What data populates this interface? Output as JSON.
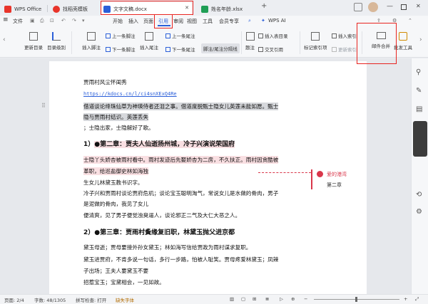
{
  "tabs": [
    {
      "label": "WPS Office"
    },
    {
      "label": "找稻壳模板"
    },
    {
      "label": "文字文稿.docx"
    },
    {
      "label": "姓名年龄.xlsx"
    }
  ],
  "menu": {
    "file": "文件",
    "items": [
      "开始",
      "插入",
      "页面",
      "引用",
      "审阅",
      "视图",
      "工具",
      "会员专享"
    ],
    "wps_ai": "WPS AI"
  },
  "ribbon": {
    "update_toc": "更新目录",
    "toc_level": "目录级别",
    "insert_footnote": "插入脚注",
    "prev_footnote": "上一条脚注",
    "next_footnote": "下一条脚注",
    "insert_endnote": "插入尾注",
    "prev_endnote": "上一条尾注",
    "next_endnote": "下一条尾注",
    "footnote_sep": "脚注/尾注分隔线",
    "caption": "题注",
    "insert_toa": "插入表目录",
    "cross_ref": "交叉引用",
    "mark_index": "标记索引项",
    "insert_index": "插入索引",
    "update_index": "更新索引",
    "mail_merge": "邮件合并",
    "comment_tools": "批发工具"
  },
  "doc": {
    "line1": "贾雨村风尘怀闺秀",
    "link": "https://kdocs.cn/l/ci4snXExQ4Re",
    "line2a": "借道谈论绛珠仙草为神瑛侍者还泪之事。借道度脱甄士隐女儿英莲未能如愿。甄士",
    "line2b": "隐与贾雨村结识。英莲丢失",
    "line3": "；士隐出家，士隐解好了歌。",
    "h1_num": "1）",
    "h1": "●第二章：贾夫人仙逝扬州城，冷子兴演说荣国府",
    "p4a": "士隐丫头娇杏被雨村看中。雨村发迹后先娶娇杏为二房，不久扶正。雨村因贪酷被",
    "p4b": "革职，给巡盐御史林如海独",
    "p5": "生女儿林黛玉教书识字。",
    "p6a": "冷子兴和贾雨村谈论贾府危机；谈论宝玉聪明淘气，常说女儿是水做的骨肉，男子",
    "p6b": "是泥做的骨肉，我见了女儿",
    "p7": "便清爽，见了男子便觉浊臭逼人，谈论邪正二气及大仁大恶之人。",
    "h2_num": "2）",
    "h2": "●第三章：贾雨村夤缘复旧职，林黛玉抛父进京都",
    "p8": "黛玉母逝；贾母要接外孙女黛玉；林如海写信给贾政为雨村谋求复职。",
    "p9a": "黛玉进贾府，不肯多说一句话，多行一步路，怕被人耻笑。贾母疼爱林黛玉；凤辣",
    "p9b": "子出场；王夫人要黛玉不要",
    "p10": "招惹宝玉；宝黛相会，一见如故。"
  },
  "comment": {
    "author": "爱的港湾",
    "text": "第二章"
  },
  "status": {
    "page": "页面: 2/4",
    "words": "字数: 48/1305",
    "spell": "拼写检查: 打开",
    "font_missing": "缺失字体"
  },
  "colors": {
    "accent": "#2b5fd9",
    "highlight_gray": "#d6d8dc",
    "highlight_pink": "#f9dfe2",
    "annotation_red": "#e8231f",
    "comment_red": "#d9364a"
  }
}
